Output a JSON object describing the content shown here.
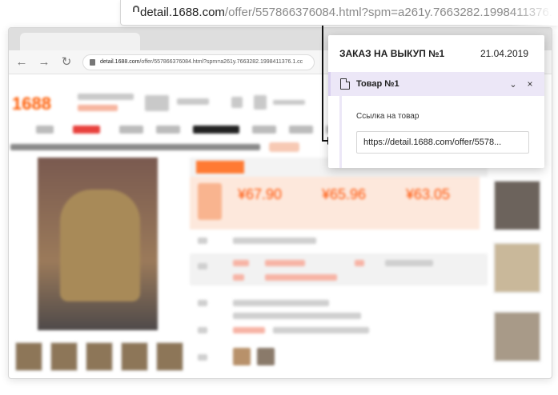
{
  "address_bar": {
    "domain": "detail.1688.com",
    "path": "/offer/557866376084.html?spm=a261y.7663282.1998411376.1.c"
  },
  "background_browser": {
    "url_domain": "detail.1688.com",
    "url_path": "/offer/557866376084.html?spm=a261y.7663282.1998411376.1.cc",
    "site_logo": "1688",
    "prices": [
      "¥67.90",
      "¥65.96",
      "¥63.05"
    ]
  },
  "order_panel": {
    "title": "ЗАКАЗ НА ВЫКУП №1",
    "date": "21.04.2019",
    "item": {
      "title": "Товар №1",
      "link_label": "Ссылка на товар",
      "link_value": "https://detail.1688.com/offer/5578..."
    }
  },
  "icons": {
    "lock": "lock-icon",
    "document": "document-icon",
    "chevron": "chevron-down-icon",
    "close": "close-icon"
  },
  "colors": {
    "accent_lavender": "#ece7f7",
    "brand_orange": "#ff5a00",
    "price_red": "#ff5000"
  }
}
